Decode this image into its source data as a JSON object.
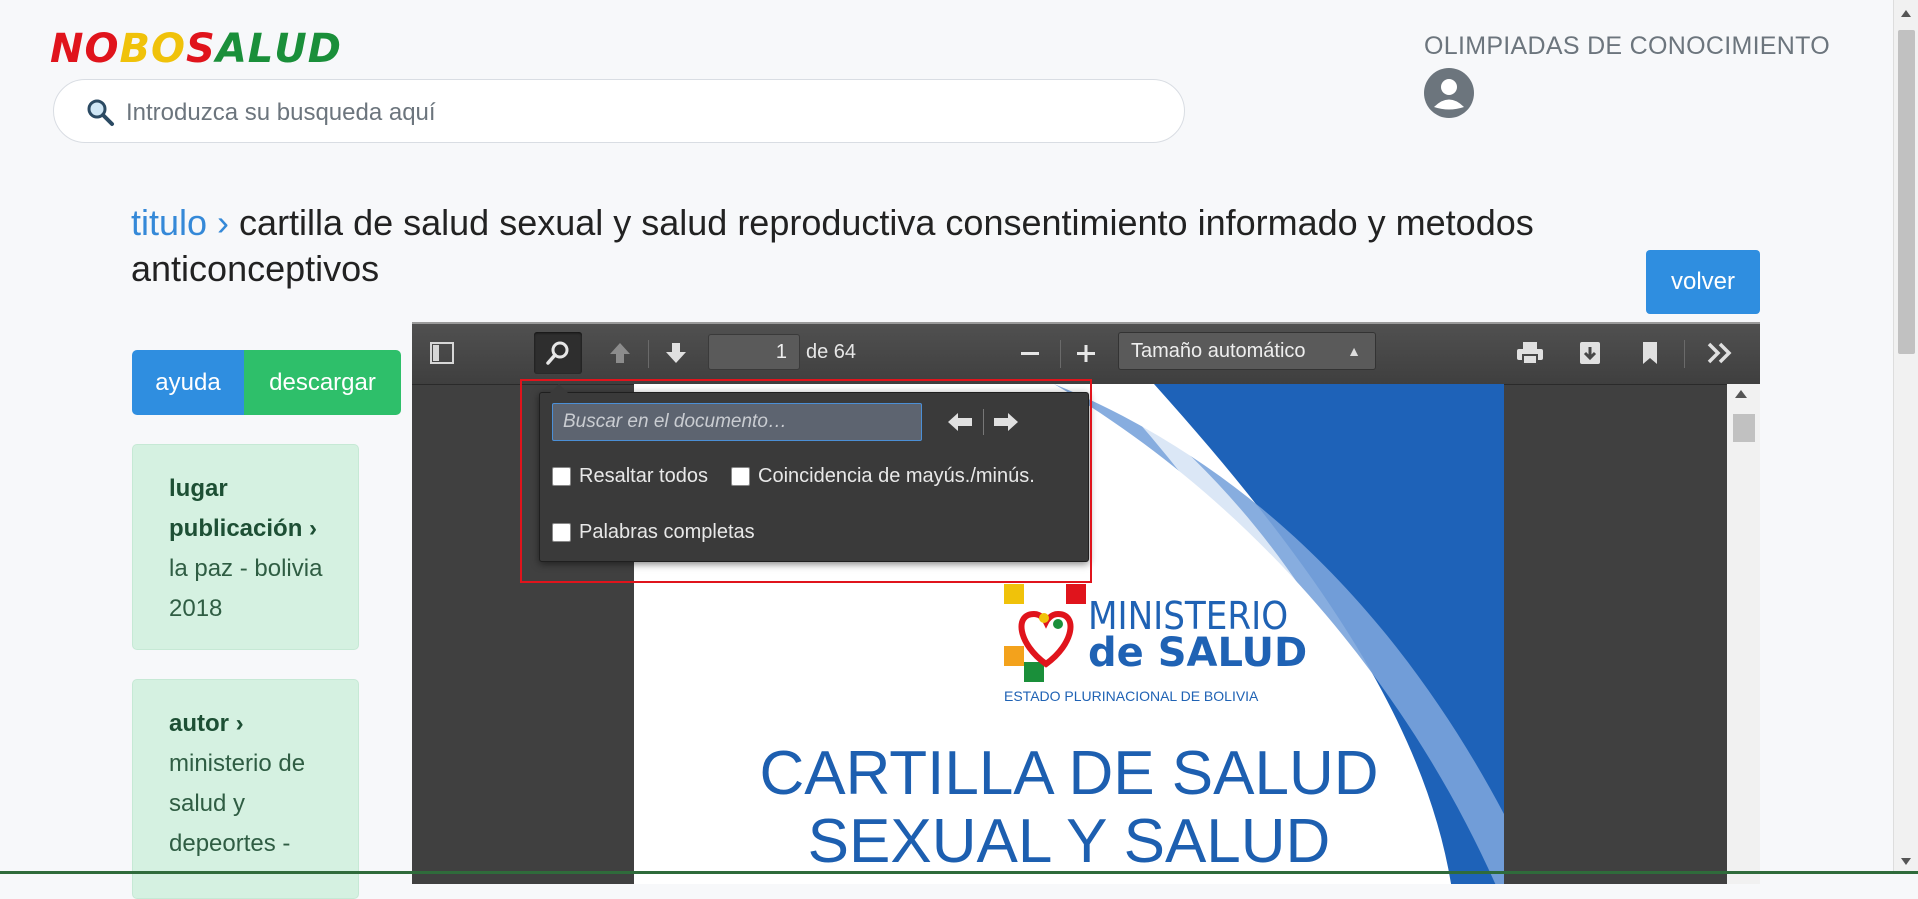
{
  "brand": {
    "logo_letters": [
      {
        "ch": "N",
        "color": "#e0141c"
      },
      {
        "ch": "O",
        "color": "#e0141c"
      },
      {
        "ch": "B",
        "color": "#f0c20a"
      },
      {
        "ch": "O",
        "color": "#f0c20a"
      },
      {
        "ch": "S",
        "color": "#e0141c"
      },
      {
        "ch": "A",
        "color": "#1a8f3a"
      },
      {
        "ch": "L",
        "color": "#1a8f3a"
      },
      {
        "ch": "U",
        "color": "#1a8f3a"
      },
      {
        "ch": "D",
        "color": "#1a8f3a"
      }
    ]
  },
  "search": {
    "placeholder": "Introduzca su busqueda aquí",
    "icon": "search-icon"
  },
  "header": {
    "olimpiadas": "OLIMPIADAS DE CONOCIMIENTO",
    "avatar_icon": "user-avatar-icon"
  },
  "title": {
    "link": "titulo ›",
    "text": " cartilla de salud sexual y salud reproductiva consentimiento informado y metodos anticonceptivos"
  },
  "actions": {
    "volver": "volver",
    "ayuda": "ayuda",
    "descargar": "descargar"
  },
  "sidebar": {
    "place_label": "lugar publicación ›",
    "place_value": "la paz - bolivia 2018",
    "author_label": "autor ›",
    "author_value": "ministerio de salud y depeortes -"
  },
  "viewer": {
    "page_number": "1",
    "page_total": "de 64",
    "zoom": "Tamaño automático",
    "find_placeholder": "Buscar en el documento…",
    "opt_highlight": "Resaltar todos",
    "opt_match_case": "Coincidencia de mayús./minús.",
    "opt_whole_words": "Palabras completas"
  },
  "cover": {
    "ministerio": "MINISTERIO",
    "de_salud": "de SALUD",
    "estado": "ESTADO PLURINACIONAL DE BOLIVIA",
    "line1": "CARTILLA DE SALUD",
    "line2": "SEXUAL Y SALUD"
  },
  "colors": {
    "accent_blue": "#2f8ee0",
    "accent_green": "#2ebf6a",
    "highlight_red": "#e0141c"
  }
}
